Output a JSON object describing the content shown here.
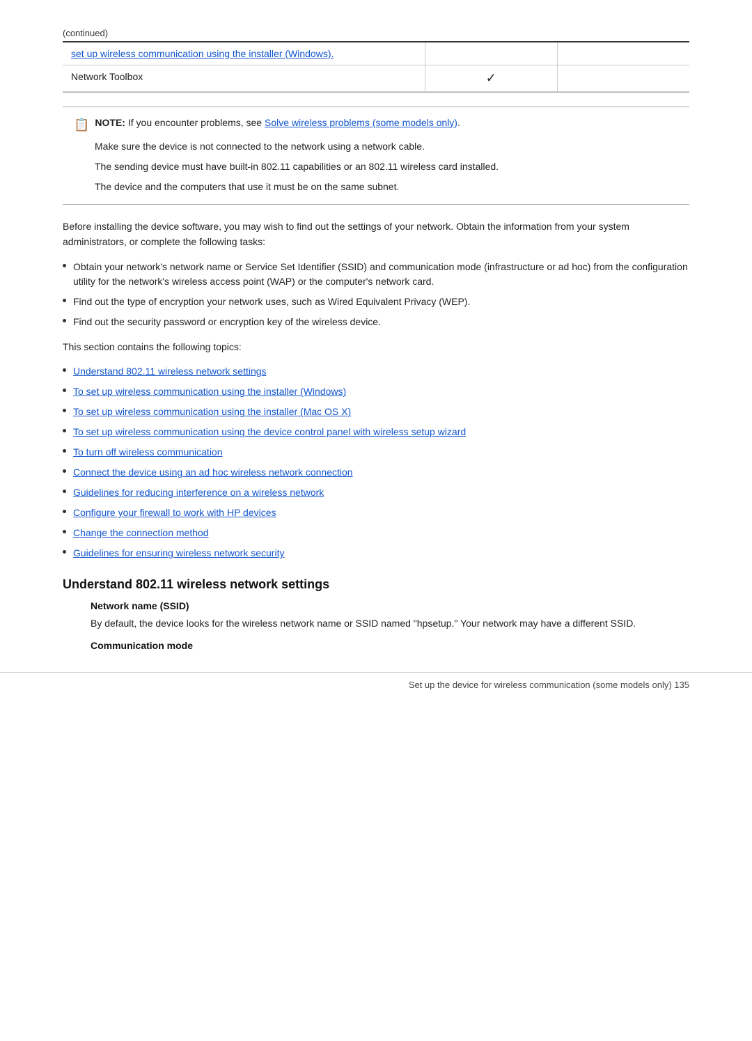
{
  "page": {
    "continued_label": "(continued)",
    "table": {
      "rows": [
        {
          "col1_link": "set up wireless communication using the installer (Windows).",
          "col2": "",
          "col3": ""
        },
        {
          "col1_text": "Network Toolbox",
          "col2": "✓",
          "col3": ""
        }
      ]
    },
    "note": {
      "keyword": "NOTE:",
      "intro": "If you encounter problems, see ",
      "link_text": "Solve wireless problems (some models only)",
      "link_suffix": ".",
      "paragraphs": [
        "Make sure the device is not connected to the network using a network cable.",
        "The sending device must have built-in 802.11 capabilities or an 802.11 wireless card installed.",
        "The device and the computers that use it must be on the same subnet."
      ]
    },
    "intro_paragraph": "Before installing the device software, you may wish to find out the settings of your network. Obtain the information from your system administrators, or complete the following tasks:",
    "bullet_items": [
      "Obtain your network's network name or Service Set Identifier (SSID) and communication mode (infrastructure or ad hoc) from the configuration utility for the network's wireless access point (WAP) or the computer's network card.",
      "Find out the type of encryption your network uses, such as Wired Equivalent Privacy (WEP).",
      "Find out the security password or encryption key of the wireless device."
    ],
    "topics_intro": "This section contains the following topics:",
    "topics_links": [
      "Understand 802.11 wireless network settings",
      "To set up wireless communication using the installer (Windows)",
      "To set up wireless communication using the installer (Mac OS X)",
      "To set up wireless communication using the device control panel with wireless setup wizard",
      "To turn off wireless communication",
      "Connect the device using an ad hoc wireless network connection",
      "Guidelines for reducing interference on a wireless network",
      "Configure your firewall to work with HP devices",
      "Change the connection method",
      "Guidelines for ensuring wireless network security"
    ],
    "section_heading": "Understand 802.11 wireless network settings",
    "network_name_heading": "Network name (SSID)",
    "network_name_paragraph": "By default, the device looks for the wireless network name or SSID named \"hpsetup.\" Your network may have a different SSID.",
    "comm_mode_heading": "Communication mode",
    "footer_left": "",
    "footer_right": "Set up the device for wireless communication (some models only)     135"
  }
}
